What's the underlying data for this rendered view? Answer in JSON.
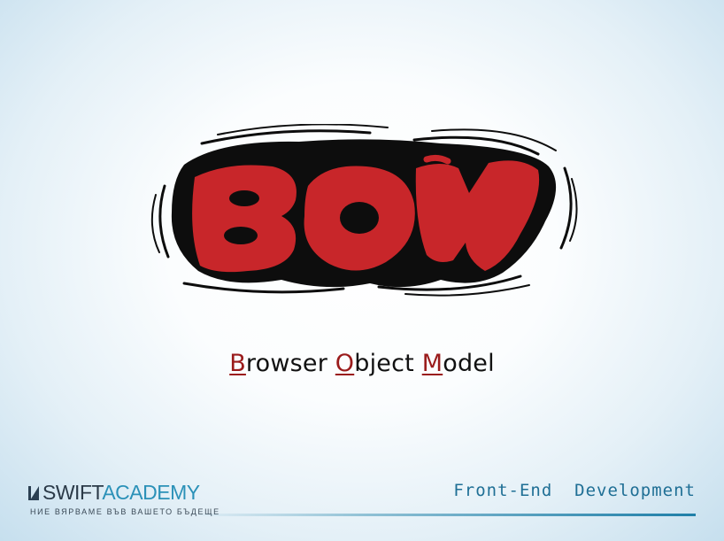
{
  "logo": {
    "text": "BOM",
    "fill_color": "#c8262a",
    "outline_color": "#0d0d0d"
  },
  "subtitle": {
    "b_letter": "B",
    "b_rest": "rowser ",
    "o_letter": "O",
    "o_rest": "bject ",
    "m_letter": "M",
    "m_rest": "odel",
    "highlight_color": "#9a1b1b"
  },
  "brand": {
    "name_part1": "SWIFT",
    "name_part2": "ACADEMY",
    "tagline": "НИЕ ВЯРВАМЕ ВЪВ ВАШЕТО БЪДЕЩЕ"
  },
  "course": {
    "label": "Front-End  Development",
    "accent_color": "#1f6f95"
  }
}
